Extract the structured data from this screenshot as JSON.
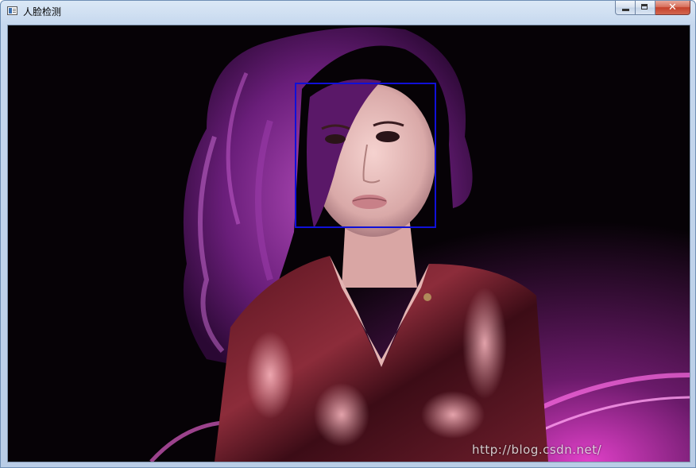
{
  "window": {
    "title": "人脸检测",
    "controls": {
      "minimize_icon": "minimize-icon",
      "maximize_icon": "maximize-icon",
      "close_icon": "close-icon"
    }
  },
  "canvas": {
    "detection_box_color": "#1010d8",
    "watermark": "http://blog.csdn.net/"
  }
}
